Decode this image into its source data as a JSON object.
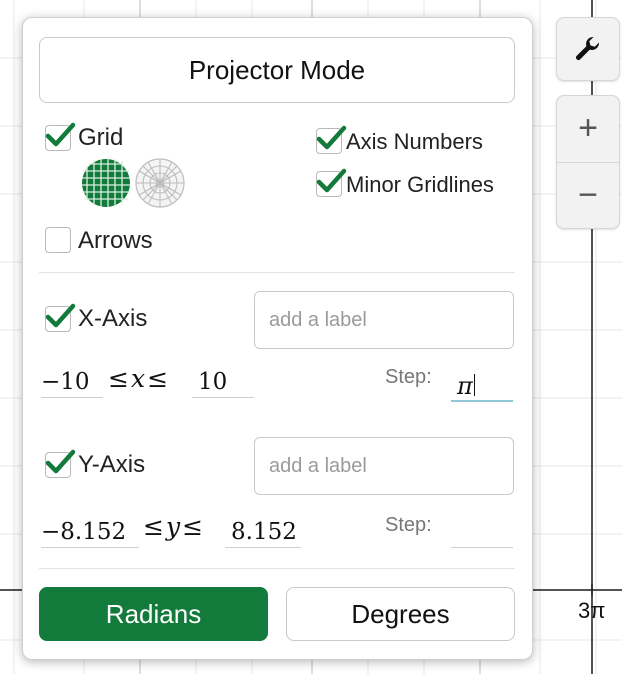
{
  "colors": {
    "accent": "#127a3a",
    "grid": "#dcdcdc",
    "axis": "#1a1a1a"
  },
  "panel": {
    "projector_label": "Projector Mode",
    "grid": {
      "label": "Grid",
      "checked": true,
      "cartesian_icon": "cartesian-grid-icon",
      "polar_icon": "polar-grid-icon"
    },
    "axis_numbers": {
      "label": "Axis Numbers",
      "checked": true
    },
    "minor_gridlines": {
      "label": "Minor Gridlines",
      "checked": true
    },
    "arrows": {
      "label": "Arrows",
      "checked": false
    },
    "x_axis": {
      "label": "X-Axis",
      "checked": true,
      "label_placeholder": "add a label",
      "min": "−10",
      "var": "x",
      "max": "10",
      "step_label": "Step:",
      "step_value": "π"
    },
    "y_axis": {
      "label": "Y-Axis",
      "checked": true,
      "label_placeholder": "add a label",
      "min": "−8.152",
      "var": "y",
      "max": "8.152",
      "step_label": "Step:",
      "step_value": ""
    },
    "radians_label": "Radians",
    "degrees_label": "Degrees",
    "leq": "≤"
  },
  "graph": {
    "tick_label": "3π"
  },
  "side": {
    "wrench_icon": "wrench-icon",
    "zoom_in_icon": "plus-icon",
    "zoom_out_icon": "minus-icon",
    "zoom_in": "+",
    "zoom_out": "−"
  }
}
